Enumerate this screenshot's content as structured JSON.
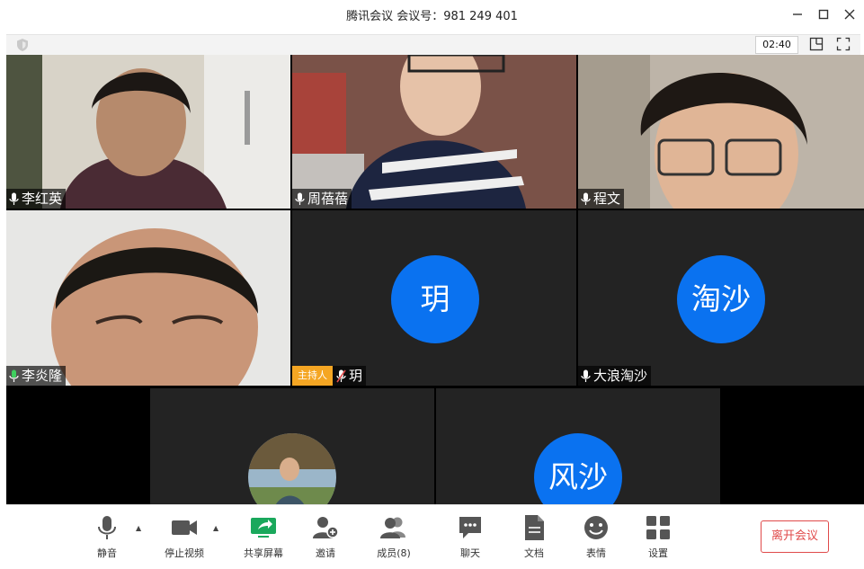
{
  "window": {
    "title": "腾讯会议 会议号：981 249 401",
    "minimize_icon": "minimize-icon",
    "maximize_icon": "maximize-icon",
    "close_icon": "close-icon"
  },
  "topbar": {
    "timer": "02:40",
    "icons": [
      "shield-icon",
      "layout-icon",
      "fullscreen-icon"
    ]
  },
  "participants": [
    {
      "name": "李红英",
      "type": "video",
      "skin": "#b68a6c",
      "bg": "#d8d3c8"
    },
    {
      "name": "周蓓蓓",
      "type": "video",
      "skin": "#e6c2a8",
      "bg": "#a8433a"
    },
    {
      "name": "程文",
      "type": "video",
      "skin": "#e0b596",
      "bg": "#bdb4a8"
    },
    {
      "name": "李炎隆",
      "type": "video",
      "skin": "#c99678",
      "bg": "#e7e7e5"
    },
    {
      "name": "玥",
      "type": "avatar",
      "avatar_text": "玥",
      "host_badge": "主持人",
      "muted": true
    },
    {
      "name": "大浪淘沙",
      "type": "avatar",
      "avatar_text": "淘沙"
    },
    {
      "name": "",
      "type": "photo-avatar"
    },
    {
      "name": "",
      "type": "avatar",
      "avatar_text": "风沙"
    }
  ],
  "controls": [
    {
      "label": "静音",
      "icon": "microphone-icon",
      "caret": true
    },
    {
      "label": "停止视频",
      "icon": "camera-icon",
      "caret": true
    },
    {
      "label": "共享屏幕",
      "icon": "share-screen-icon"
    },
    {
      "label": "邀请",
      "icon": "invite-icon"
    },
    {
      "label": "成员(8)",
      "icon": "members-icon"
    },
    {
      "label": "聊天",
      "icon": "chat-icon"
    },
    {
      "label": "文档",
      "icon": "document-icon"
    },
    {
      "label": "表情",
      "icon": "emoji-icon"
    },
    {
      "label": "设置",
      "icon": "settings-icon"
    }
  ],
  "leave_button": "离开会议",
  "colors": {
    "accent": "#0a72f0",
    "host": "#f5a623",
    "leave": "#e04a4a",
    "share": "#1aa85c"
  }
}
